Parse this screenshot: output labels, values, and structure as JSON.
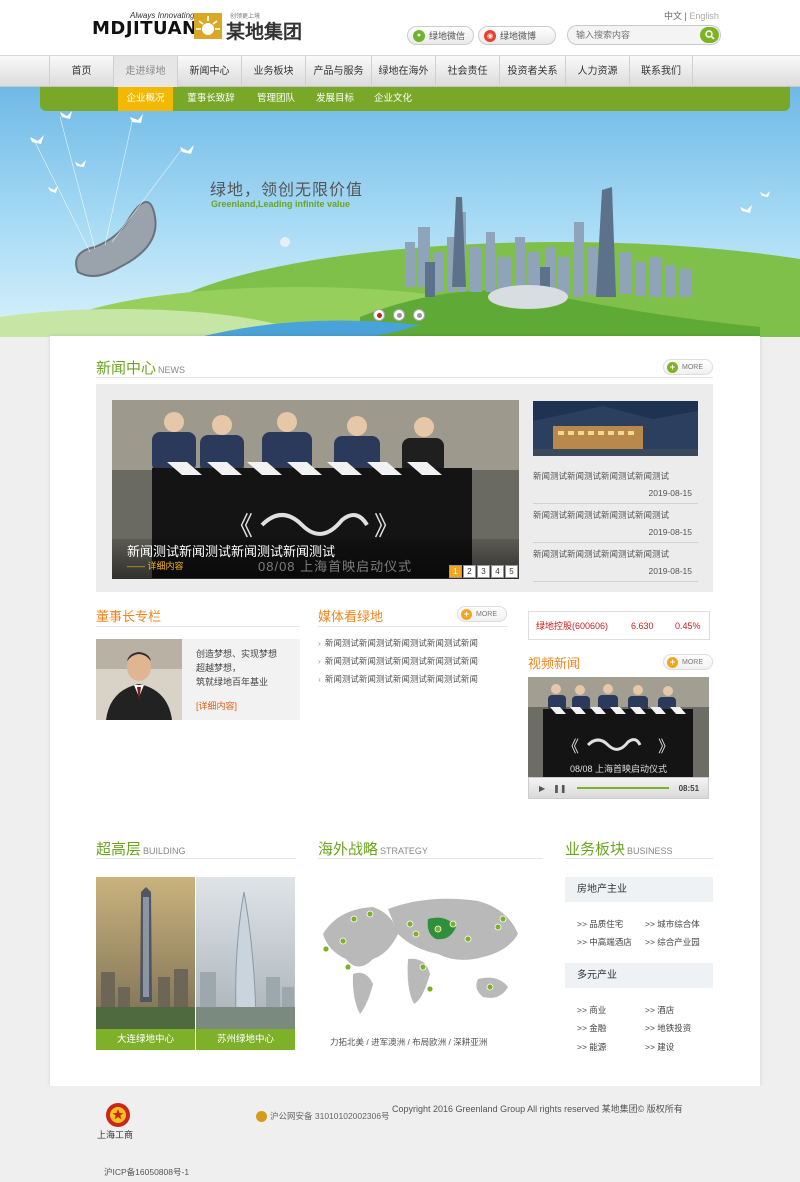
{
  "header": {
    "logo_en": "MDJITUAN",
    "logo_tagline": "Always Innovating",
    "logo_cn": "某地集团",
    "logo_cn_small": "创领更上境",
    "lang_cn": "中文",
    "lang_sep": "|",
    "lang_en": "English",
    "wechat_label": "绿地微信",
    "weibo_label": "绿地微博",
    "search_placeholder": "输入搜索内容"
  },
  "nav": {
    "items": [
      "首页",
      "走进绿地",
      "新闻中心",
      "业务板块",
      "产品与服务",
      "绿地在海外",
      "社会责任",
      "投资者关系",
      "人力资源",
      "联系我们"
    ],
    "active_index": 1
  },
  "subnav": {
    "items": [
      "企业概况",
      "董事长致辞",
      "管理团队",
      "发展目标",
      "企业文化"
    ],
    "active_index": 0
  },
  "banner": {
    "title": "绿地，领创无限价值",
    "subtitle": "Greenland,Leading infinite value",
    "active_dot": 0
  },
  "news": {
    "title": "新闻中心",
    "title_en": "NEWS",
    "more": "MORE",
    "featured_title": "新闻测试新闻测试新闻测试新闻测试",
    "featured_link": "详细内容",
    "photo_text": "08/08 上海首映启动仪式",
    "pages": [
      "1",
      "2",
      "3",
      "4",
      "5"
    ],
    "side_items": [
      {
        "title": "新闻测试新闻测试新闻测试新闻测试",
        "date": "2019-08-15"
      },
      {
        "title": "新闻测试新闻测试新闻测试新闻测试",
        "date": "2019-08-15"
      },
      {
        "title": "新闻测试新闻测试新闻测试新闻测试",
        "date": "2019-08-15"
      }
    ]
  },
  "chairman": {
    "title": "董事长专栏",
    "text_1": "创造梦想、实现梦想",
    "text_2": "超越梦想，",
    "text_3": "筑就绿地百年基业",
    "link": "[详细内容]"
  },
  "media": {
    "title": "媒体看绿地",
    "more": "MORE",
    "items": [
      "新闻测试新闻测试新闻测试新闻测试新闻",
      "新闻测试新闻测试新闻测试新闻测试新闻",
      "新闻测试新闻测试新闻测试新闻测试新闻"
    ]
  },
  "stock": {
    "name": "绿地控股(600606)",
    "price": "6.630",
    "change": "0.45%"
  },
  "video": {
    "title": "视频新闻",
    "more": "MORE",
    "time": "08:51",
    "overlay": "08/08 上海首映启动仪式"
  },
  "building": {
    "title": "超高层",
    "title_en": "BUILDING",
    "items": [
      "大连绿地中心",
      "苏州绿地中心"
    ]
  },
  "strategy": {
    "title": "海外战略",
    "title_en": "STRATEGY",
    "caption": "力拓北美 / 进军澳洲 / 布局欧洲 / 深耕亚洲"
  },
  "business": {
    "title": "业务板块",
    "title_en": "BUSINESS",
    "group1_title": "房地产主业",
    "group1": [
      ">> 品质住宅",
      ">> 城市综合体",
      ">> 中高端酒店",
      ">> 综合产业园"
    ],
    "group2_title": "多元产业",
    "group2": [
      ">> 商业",
      ">> 酒店",
      ">> 金融",
      ">> 地铁投资",
      ">> 能源",
      ">> 建设"
    ]
  },
  "footer": {
    "gongshang": "上海工商",
    "police": "沪公网安备 31010102002306号",
    "copyright": "Copyright 2016 Greenland Group All rights reserved 某地集团© 版权所有",
    "icp": "沪ICP备16050808号-1"
  },
  "colors": {
    "brand_green": "#79a828",
    "accent_orange": "#f3a51c",
    "stock_red": "#c81d1d"
  }
}
